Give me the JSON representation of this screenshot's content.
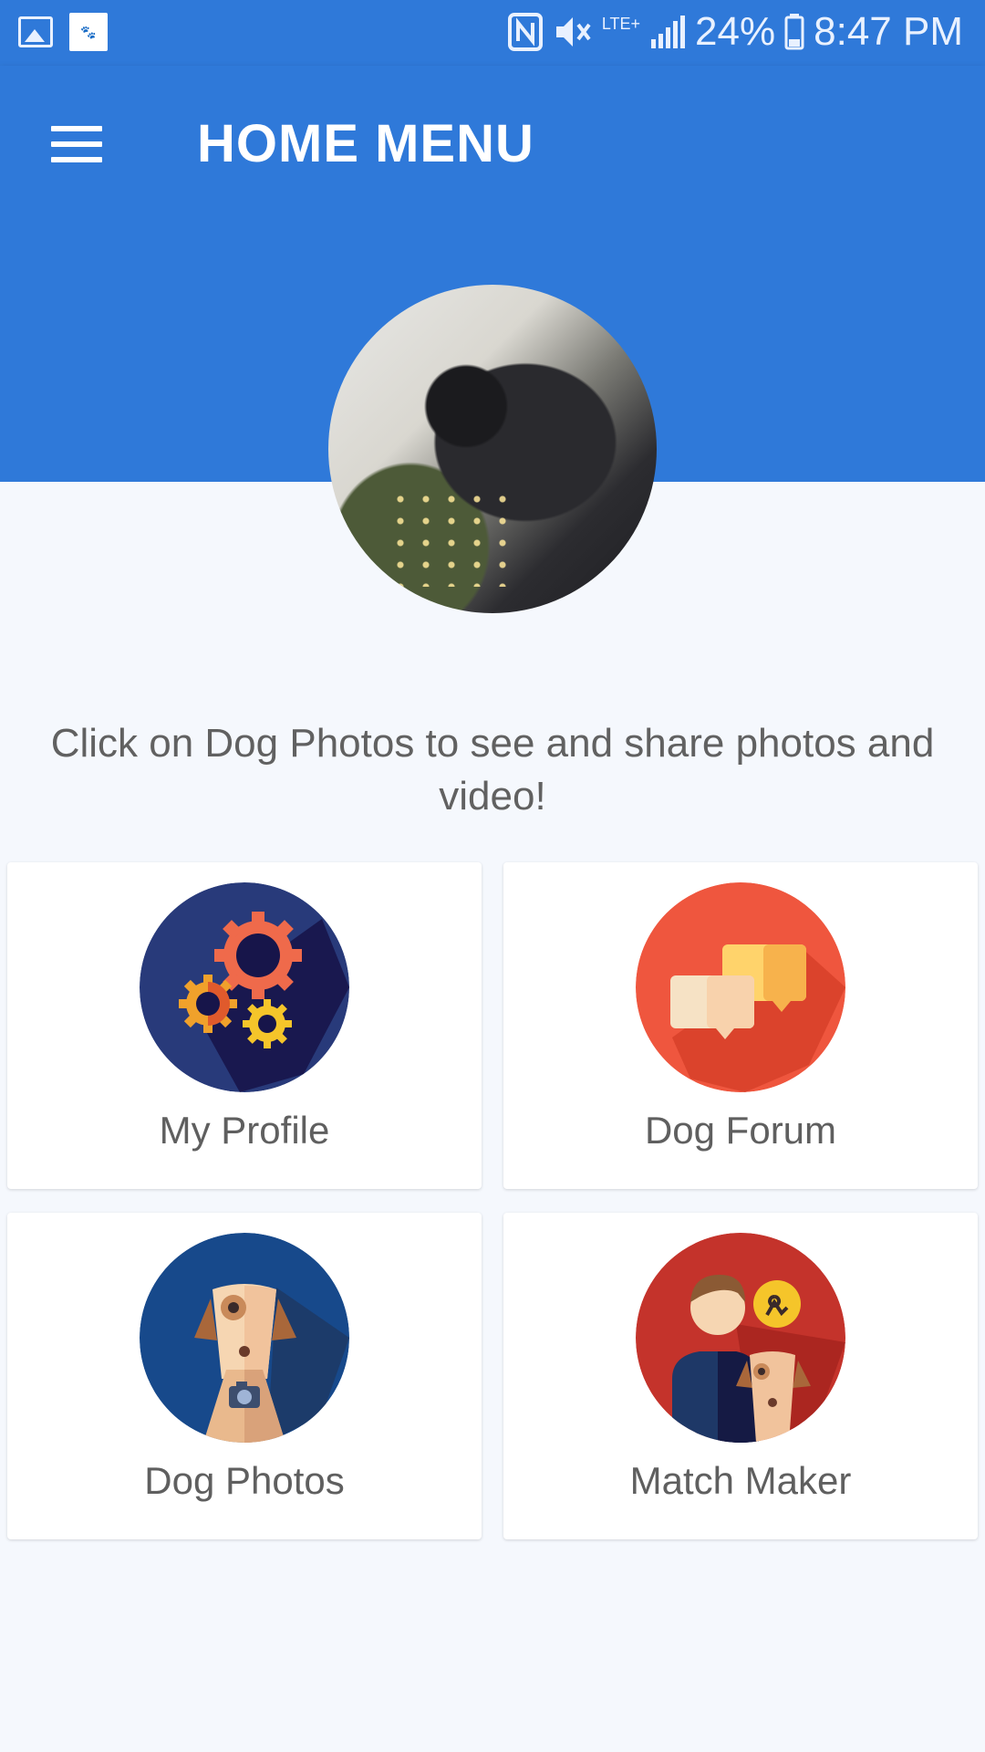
{
  "status_bar": {
    "battery": "24%",
    "time": "8:47 PM",
    "network": "LTE+"
  },
  "app_bar": {
    "title": "HOME MENU"
  },
  "info_text": "Click on Dog Photos to see and share photos and video!",
  "cards": [
    {
      "label": "My Profile",
      "icon": "gears-icon",
      "color": "#283a7a"
    },
    {
      "label": "Dog Forum",
      "icon": "chat-bubbles-icon",
      "color": "#ef563e"
    },
    {
      "label": "Dog Photos",
      "icon": "dog-camera-icon",
      "color": "#17498b"
    },
    {
      "label": "Match Maker",
      "icon": "person-dog-icon",
      "color": "#c4332b"
    }
  ],
  "colors": {
    "primary": "#2f79d9",
    "background": "#f5f8fd",
    "text": "#616161"
  }
}
